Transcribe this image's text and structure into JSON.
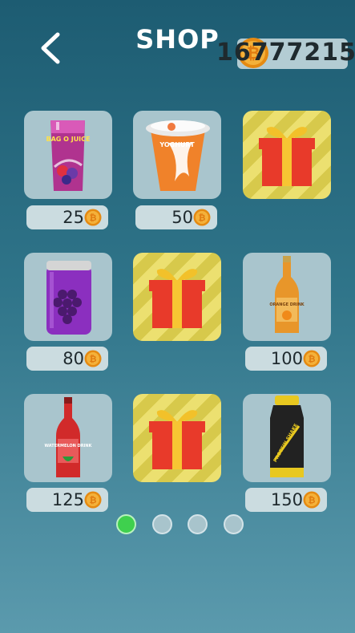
{
  "header": {
    "title": "SHOP",
    "coins": "16777215"
  },
  "items": [
    {
      "name": "bag-o-juice",
      "label": "BAG O JUICE",
      "price": "25"
    },
    {
      "name": "yoghurt",
      "label": "YOGHURT",
      "price": "50"
    },
    {
      "name": "gift",
      "price": null
    },
    {
      "name": "grape-can",
      "price": "80"
    },
    {
      "name": "gift",
      "price": null
    },
    {
      "name": "orange-bottle",
      "label": "ORANGE DRINK",
      "price": "100"
    },
    {
      "name": "watermelon-bottle",
      "label": "WATERMELON DRINK",
      "price": "125"
    },
    {
      "name": "gift",
      "price": null
    },
    {
      "name": "protein-shake",
      "label": "PROTEIN SHAKE",
      "price": "150"
    }
  ],
  "pages": {
    "count": 4,
    "active": 0
  },
  "colors": {
    "accent_green": "#3fd04e",
    "coin": "#f0a020",
    "gift_red": "#e83a2a"
  }
}
